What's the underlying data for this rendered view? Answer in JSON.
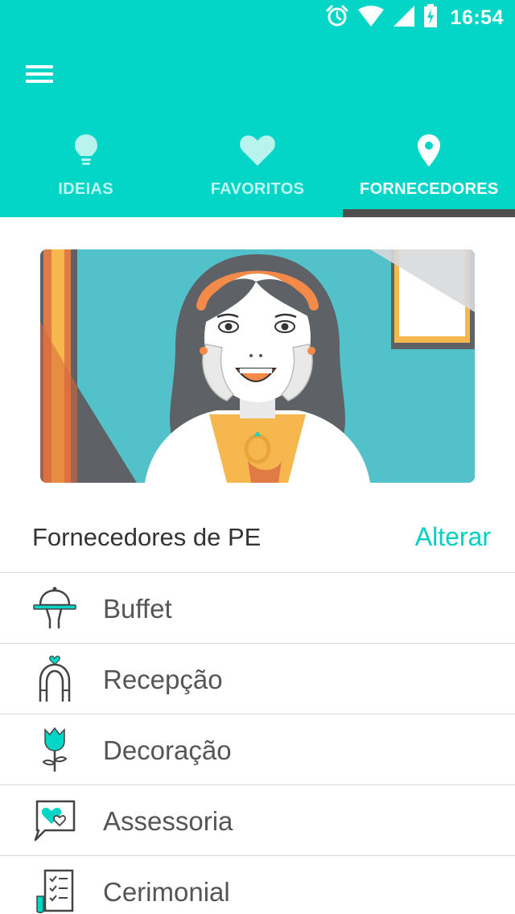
{
  "status_bar": {
    "time": "16:54",
    "icons": [
      "alarm-icon",
      "wifi-icon",
      "signal-icon",
      "battery-charging-icon"
    ]
  },
  "app_bar": {
    "menu_icon": "hamburger-menu-icon",
    "background_color": "#03D6C6"
  },
  "tabs": [
    {
      "label": "IDEIAS",
      "icon": "lightbulb-icon",
      "active": false
    },
    {
      "label": "FAVORITOS",
      "icon": "heart-icon",
      "active": false
    },
    {
      "label": "FORNECEDORES",
      "icon": "location-pin-icon",
      "active": true
    }
  ],
  "hero": {
    "image": "illustration-excited-woman-with-ring"
  },
  "section": {
    "title": "Fornecedores de PE",
    "action_label": "Alterar",
    "accent_color": "#03CFC0"
  },
  "categories": [
    {
      "label": "Buffet",
      "icon": "food-tray-icon"
    },
    {
      "label": "Recepção",
      "icon": "wedding-arch-icon"
    },
    {
      "label": "Decoração",
      "icon": "rose-icon"
    },
    {
      "label": "Assessoria",
      "icon": "hearts-chat-icon"
    },
    {
      "label": "Cerimonial",
      "icon": "checklist-icon"
    }
  ]
}
